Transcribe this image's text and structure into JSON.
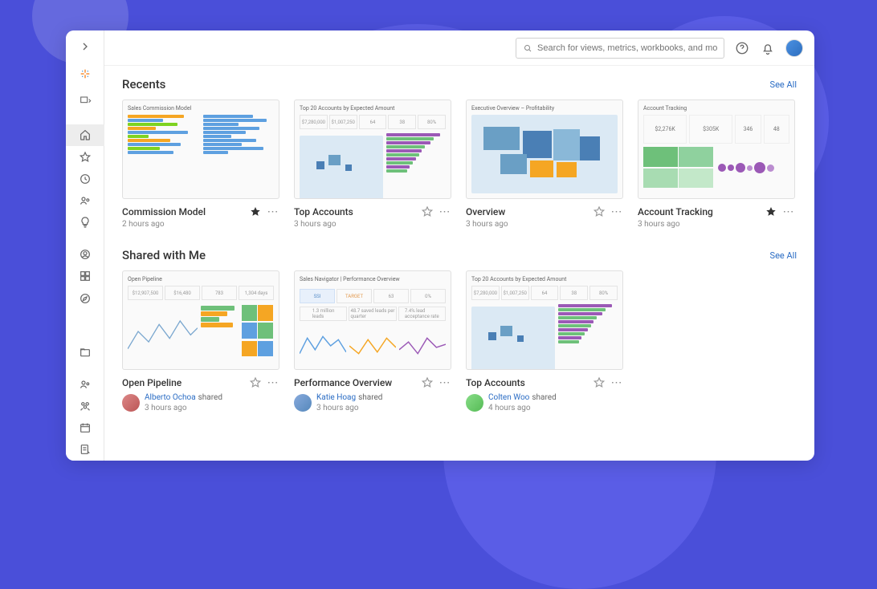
{
  "search": {
    "placeholder": "Search for views, metrics, workbooks, and more"
  },
  "sections": {
    "recents": {
      "title": "Recents",
      "see_all": "See All"
    },
    "shared": {
      "title": "Shared with Me",
      "see_all": "See All"
    }
  },
  "recents": [
    {
      "title": "Commission Model",
      "time": "2 hours ago",
      "starred": true,
      "thumb_label": "Sales Commission Model"
    },
    {
      "title": "Top Accounts",
      "time": "3 hours ago",
      "starred": false,
      "thumb_label": "Top 20 Accounts by Expected Amount"
    },
    {
      "title": "Overview",
      "time": "3 hours ago",
      "starred": false,
      "thumb_label": "Executive Overview – Profitability"
    },
    {
      "title": "Account Tracking",
      "time": "3 hours ago",
      "starred": true,
      "thumb_label": "Account Tracking"
    }
  ],
  "shared": [
    {
      "title": "Open Pipeline",
      "sharer": "Alberto Ochoa",
      "suffix": "shared",
      "time": "3 hours ago",
      "thumb_label": "Open Pipeline"
    },
    {
      "title": "Performance Overview",
      "sharer": "Katie Hoag",
      "suffix": "shared",
      "time": "3 hours ago",
      "thumb_label": "Sales Navigator | Performance Overview"
    },
    {
      "title": "Top Accounts",
      "sharer": "Colten Woo",
      "suffix": "shared",
      "time": "4 hours ago",
      "thumb_label": "Top 20 Accounts by Expected Amount"
    }
  ]
}
